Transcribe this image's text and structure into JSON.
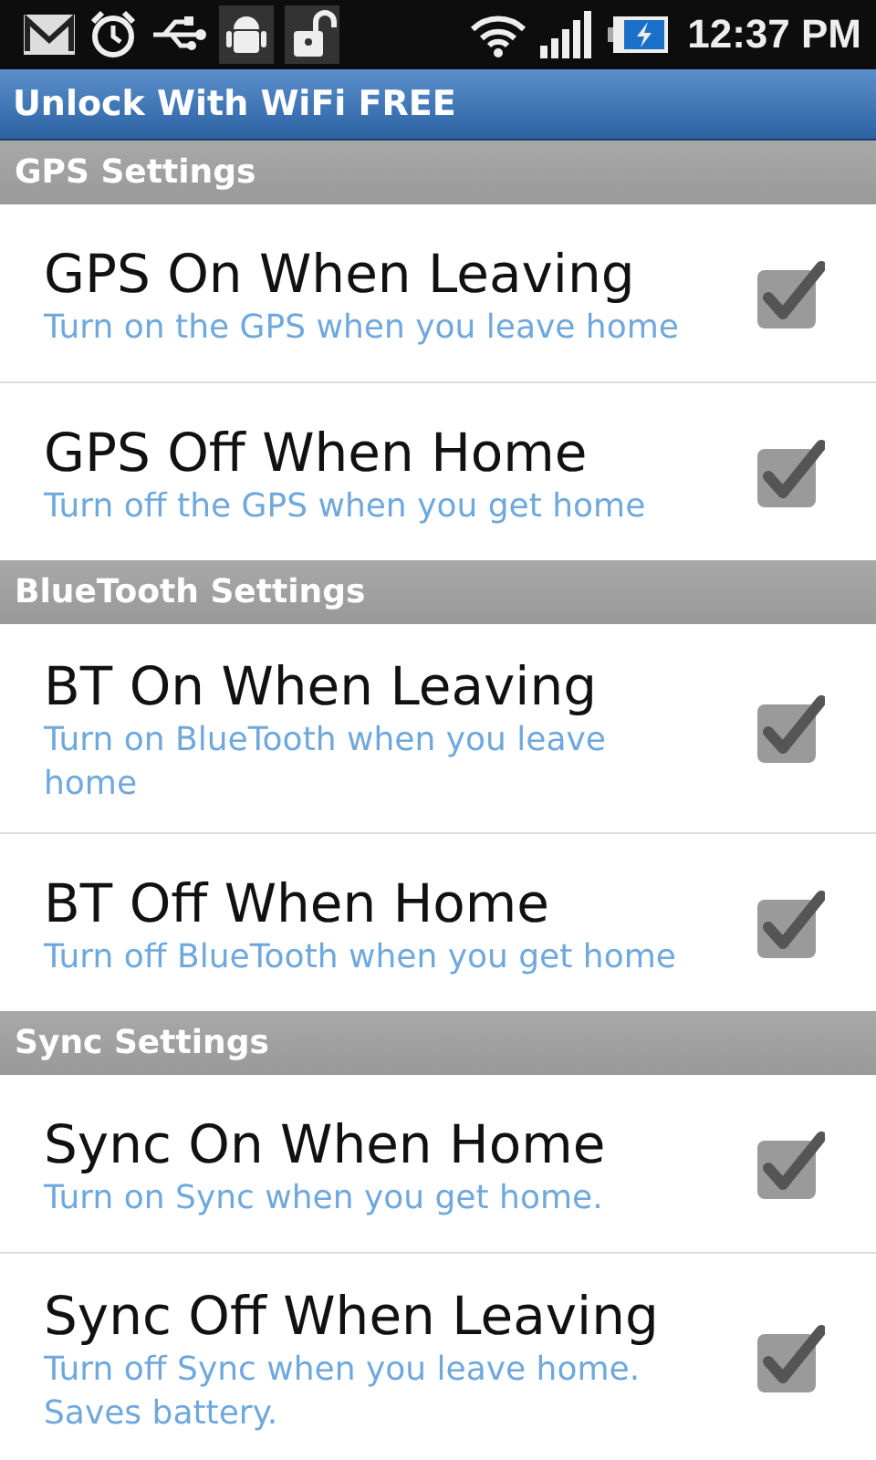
{
  "status_bar": {
    "time": "12:37 PM"
  },
  "app_bar": {
    "title": "Unlock With WiFi FREE"
  },
  "sections": [
    {
      "title": "GPS Settings",
      "items": [
        {
          "title": "GPS On When Leaving",
          "summary": "Turn on the GPS when you leave home",
          "checked": true
        },
        {
          "title": "GPS Off When Home",
          "summary": "Turn off the GPS when you get home",
          "checked": true
        }
      ]
    },
    {
      "title": "BlueTooth Settings",
      "items": [
        {
          "title": "BT On When Leaving",
          "summary": "Turn on BlueTooth when you leave home",
          "checked": true
        },
        {
          "title": "BT Off When Home",
          "summary": "Turn off BlueTooth when you get home",
          "checked": true
        }
      ]
    },
    {
      "title": "Sync Settings",
      "items": [
        {
          "title": "Sync On When Home",
          "summary": "Turn on Sync when you get home.",
          "checked": true
        },
        {
          "title": "Sync Off When Leaving",
          "summary": "Turn off Sync when you leave home. Saves battery.",
          "checked": true
        }
      ]
    }
  ]
}
